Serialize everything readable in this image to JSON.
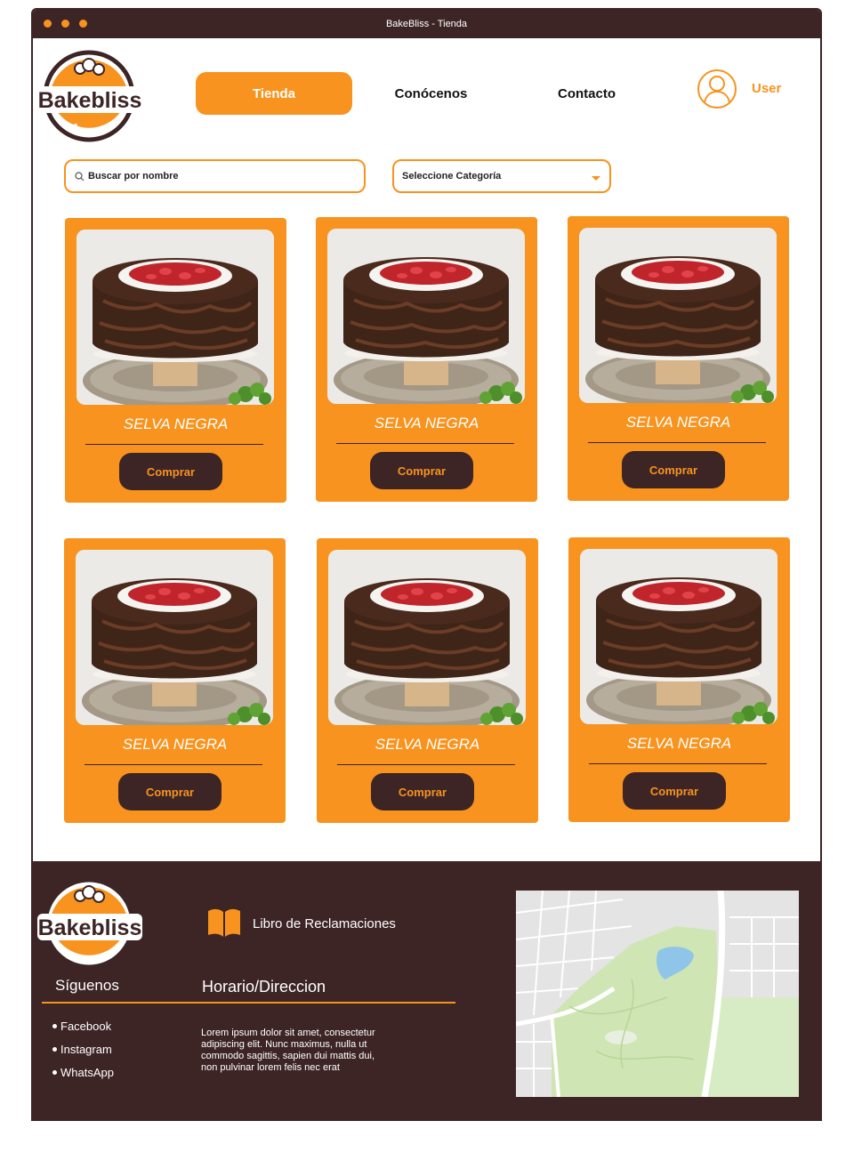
{
  "window": {
    "title": "BakeBliss - Tienda"
  },
  "brand": {
    "logo_text": "Bakebliss",
    "accent": "#f7931e",
    "dark": "#3d2526"
  },
  "nav": {
    "items": [
      {
        "label": "Tienda",
        "active": true
      },
      {
        "label": "Conócenos",
        "active": false
      },
      {
        "label": "Contacto",
        "active": false
      }
    ],
    "user_label": "User"
  },
  "filters": {
    "search_placeholder": "Buscar por nombre",
    "category_value": "Seleccione Categoría"
  },
  "products": [
    {
      "name": "SELVA NEGRA",
      "button": "Comprar"
    },
    {
      "name": "SELVA NEGRA",
      "button": "Comprar"
    },
    {
      "name": "SELVA NEGRA",
      "button": "Comprar"
    },
    {
      "name": "SELVA NEGRA",
      "button": "Comprar"
    },
    {
      "name": "SELVA NEGRA",
      "button": "Comprar"
    },
    {
      "name": "SELVA NEGRA",
      "button": "Comprar"
    }
  ],
  "footer": {
    "claims_label": "Libro de Reclamaciones",
    "follow_title": "Síguenos",
    "social": [
      "Facebook",
      "Instagram",
      "WhatsApp"
    ],
    "schedule_title": "Horario/Direccion",
    "schedule_text": "Lorem ipsum dolor sit amet, consectetur adipiscing elit. Nunc maximus, nulla ut commodo sagittis, sapien dui mattis dui, non pulvinar lorem felis nec erat"
  }
}
